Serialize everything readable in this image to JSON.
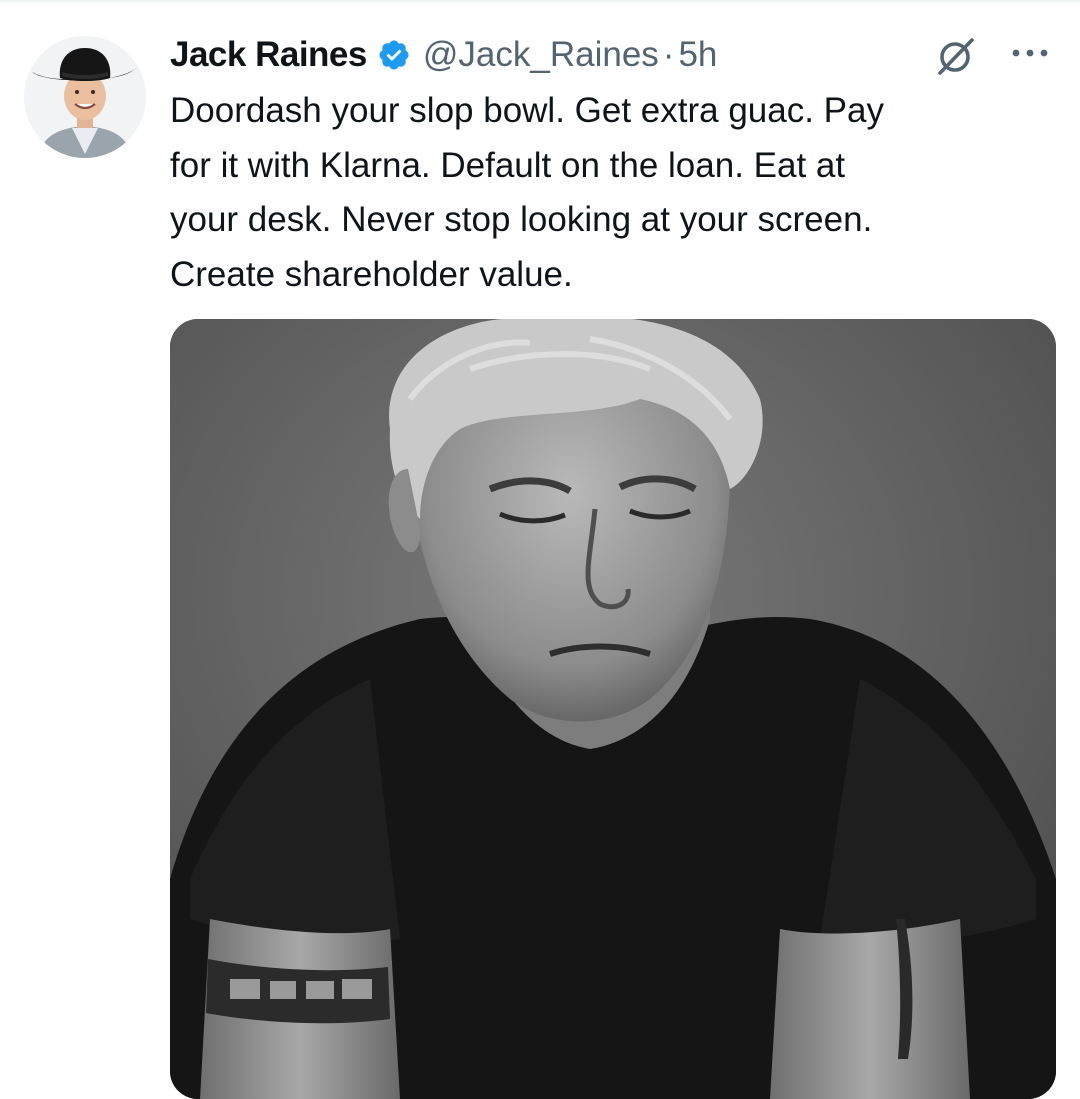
{
  "tweet": {
    "author": {
      "display_name": "Jack Raines",
      "handle": "@Jack_Raines",
      "verified": true,
      "avatar_icon": "profile-photo"
    },
    "separator": "·",
    "timestamp": "5h",
    "text": "Doordash your slop bowl. Get extra guac. Pay\nfor it with Klarna. Default on the loan. Eat at\nyour desk. Never stop looking at your screen.\nCreate shareholder value.",
    "actions": {
      "grok_icon": "grok-icon",
      "more_icon": "more-options-icon"
    },
    "media": {
      "type": "photo",
      "style": "black-and-white portrait"
    }
  },
  "colors": {
    "text_primary": "#0f1419",
    "text_secondary": "#536471",
    "verified_blue": "#1d9bf0",
    "divider": "#eff3f4"
  }
}
